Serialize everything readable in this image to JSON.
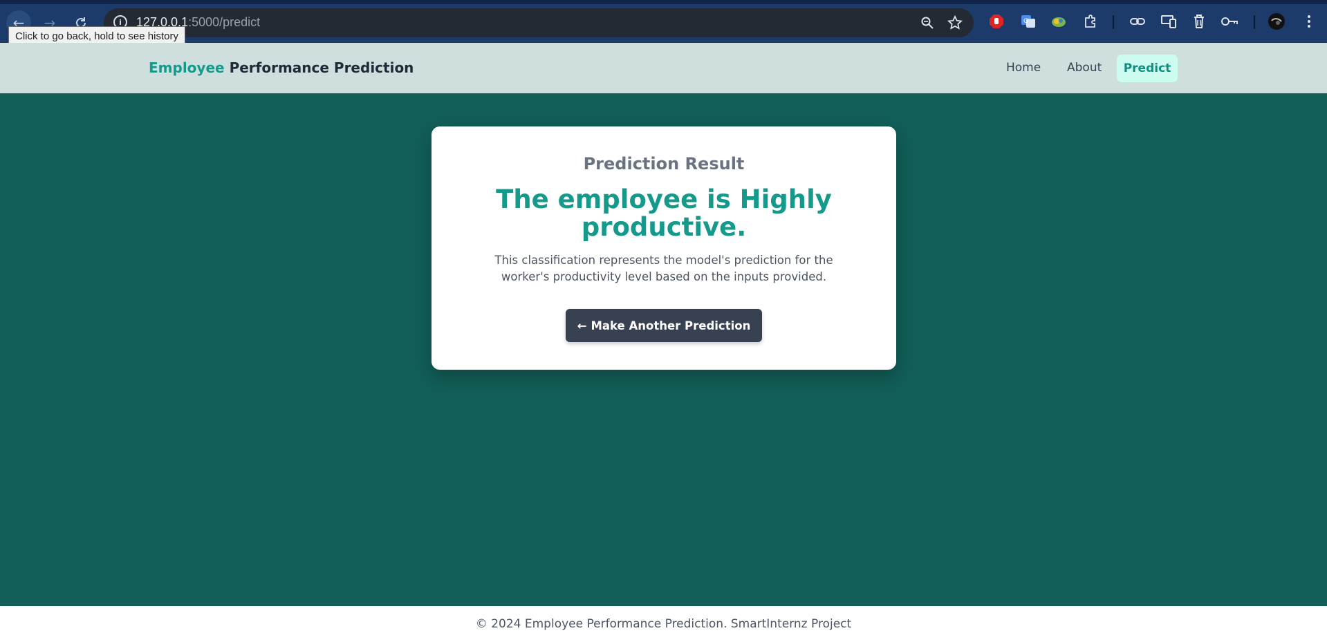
{
  "browser": {
    "url_host": "127.0.0.1",
    "url_rest": ":5000/predict",
    "tooltip": "Click to go back, hold to see history"
  },
  "header": {
    "brand_accent": "Employee",
    "brand_rest": "Performance Prediction",
    "nav": {
      "home": "Home",
      "about": "About",
      "predict": "Predict"
    }
  },
  "result_card": {
    "title": "Prediction Result",
    "result": "The employee is Highly productive.",
    "description": "This classification represents the model's prediction for the worker's productivity level based on the inputs provided.",
    "button_arrow": "←",
    "button_label": "Make Another Prediction"
  },
  "footer": {
    "text": "© 2024 Employee Performance Prediction. SmartInternz Project"
  },
  "colors": {
    "accent": "#14998a",
    "main_bg": "#125e58",
    "header_bg": "#cfdfde",
    "button_bg": "#374151",
    "active_nav_bg": "#ccfbef"
  }
}
